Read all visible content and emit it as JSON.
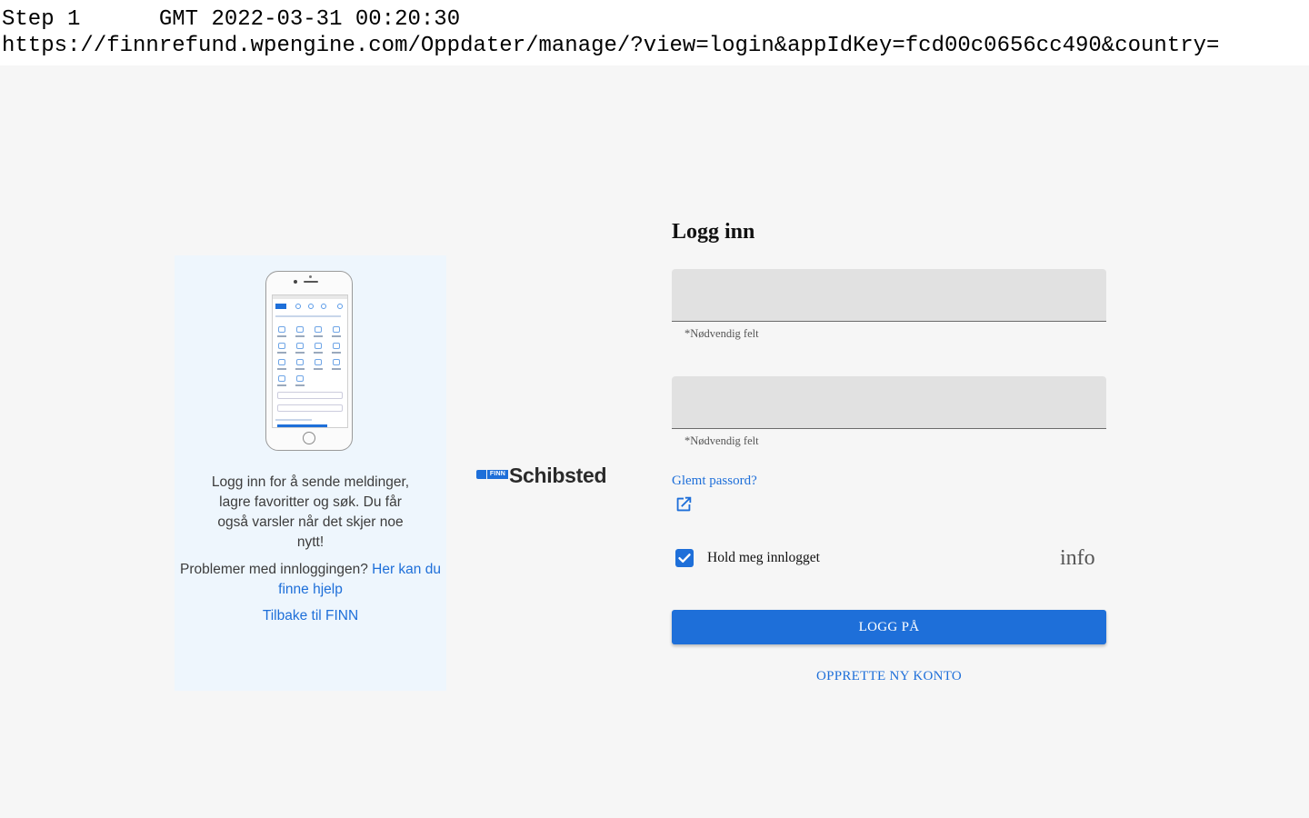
{
  "capture": {
    "step": "Step 1",
    "timestamp": "GMT 2022-03-31 00:20:30",
    "url": "https://finnrefund.wpengine.com/Oppdater/manage/?view=login&appIdKey=fcd00c0656cc490&country="
  },
  "info_panel": {
    "description": "Logg inn for å sende meldinger, lagre favoritter og søk. Du får også varsler når det skjer noe nytt!",
    "help_prefix": "Problemer med innloggingen?",
    "help_link": "Her kan du finne hjelp",
    "back_link": "Tilbake til FINN"
  },
  "brand": {
    "finn": "FINN",
    "schibsted": "Schibsted"
  },
  "login": {
    "title": "Logg inn",
    "username": {
      "value": "",
      "helper": "*Nødvendig felt"
    },
    "password": {
      "value": "",
      "helper": "*Nødvendig felt"
    },
    "forgot_password": "Glemt passord?",
    "remember_me": {
      "label": "Hold meg innlogget",
      "checked": true
    },
    "info_icon": "info",
    "submit_label": "LOGG PÅ",
    "create_account_label": "OPPRETTE NY KONTO"
  },
  "colors": {
    "primary": "#1e6fd9",
    "background": "#f6f6f6",
    "panel": "#eef6fd",
    "field": "#e1e1e1"
  }
}
